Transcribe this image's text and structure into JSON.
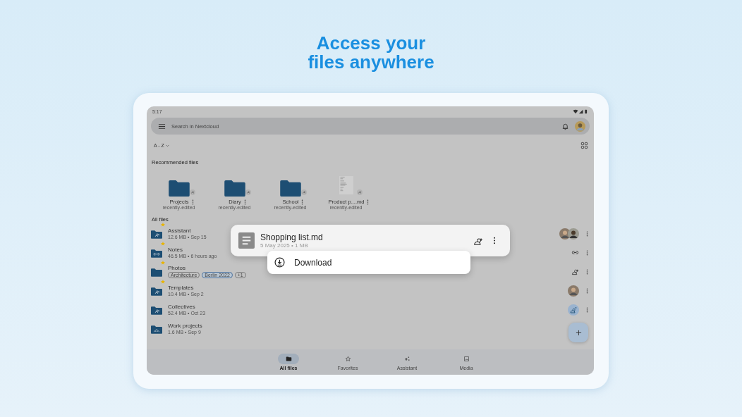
{
  "headline": [
    "Access your",
    "files anywhere"
  ],
  "status_bar": {
    "time": "5:17"
  },
  "search": {
    "placeholder": "Search in Nextcloud"
  },
  "sort": {
    "label": "A - Z"
  },
  "recommended": {
    "title": "Recommended files",
    "items": [
      {
        "name": "Projects",
        "subtitle": "recently-edited",
        "kind": "folder"
      },
      {
        "name": "Diary",
        "subtitle": "recently-edited",
        "kind": "folder"
      },
      {
        "name": "School",
        "subtitle": "recently-edited",
        "kind": "folder"
      },
      {
        "name": "Product p....md",
        "subtitle": "recently-edited",
        "kind": "document"
      }
    ]
  },
  "all_files": {
    "title": "All files",
    "items": [
      {
        "name": "Assistant",
        "meta": "12.6 MB • Sep 15",
        "starred": true,
        "folder": {
          "kind": "shared"
        },
        "status": {
          "kind": "avatars"
        }
      },
      {
        "name": "Notes",
        "meta": "46.5 MB • 6 hours ago",
        "starred": true,
        "folder": {
          "kind": "link"
        },
        "status": {
          "kind": "link"
        }
      },
      {
        "name": "Photos",
        "tags": [
          "Architecture",
          "Berlin 2022",
          "+1"
        ],
        "starred": true,
        "folder": {
          "kind": "plain"
        },
        "status": {
          "kind": "share"
        }
      },
      {
        "name": "Templates",
        "meta": "10.4 MB • Sep 2",
        "starred": true,
        "folder": {
          "kind": "shared"
        },
        "status": {
          "kind": "avatar"
        }
      },
      {
        "name": "Collectives",
        "meta": "52.4 MB • Oct 23",
        "starred": false,
        "folder": {
          "kind": "shared"
        },
        "status": {
          "kind": "shared"
        }
      },
      {
        "name": "Work projects",
        "meta": "1.6 MB • Sep 9",
        "starred": false,
        "folder": {
          "kind": "group"
        }
      }
    ]
  },
  "popup": {
    "name": "Shopping list.md",
    "meta": "5 May 2025 • 1 MB",
    "menu": [
      {
        "label": "Download"
      }
    ]
  },
  "nav": [
    {
      "label": "All files",
      "selected": true,
      "kind": "folder"
    },
    {
      "label": "Favorites",
      "selected": false,
      "kind": "star"
    },
    {
      "label": "Assistant",
      "selected": false,
      "kind": "sparkle"
    },
    {
      "label": "Media",
      "selected": false,
      "kind": "image"
    }
  ]
}
